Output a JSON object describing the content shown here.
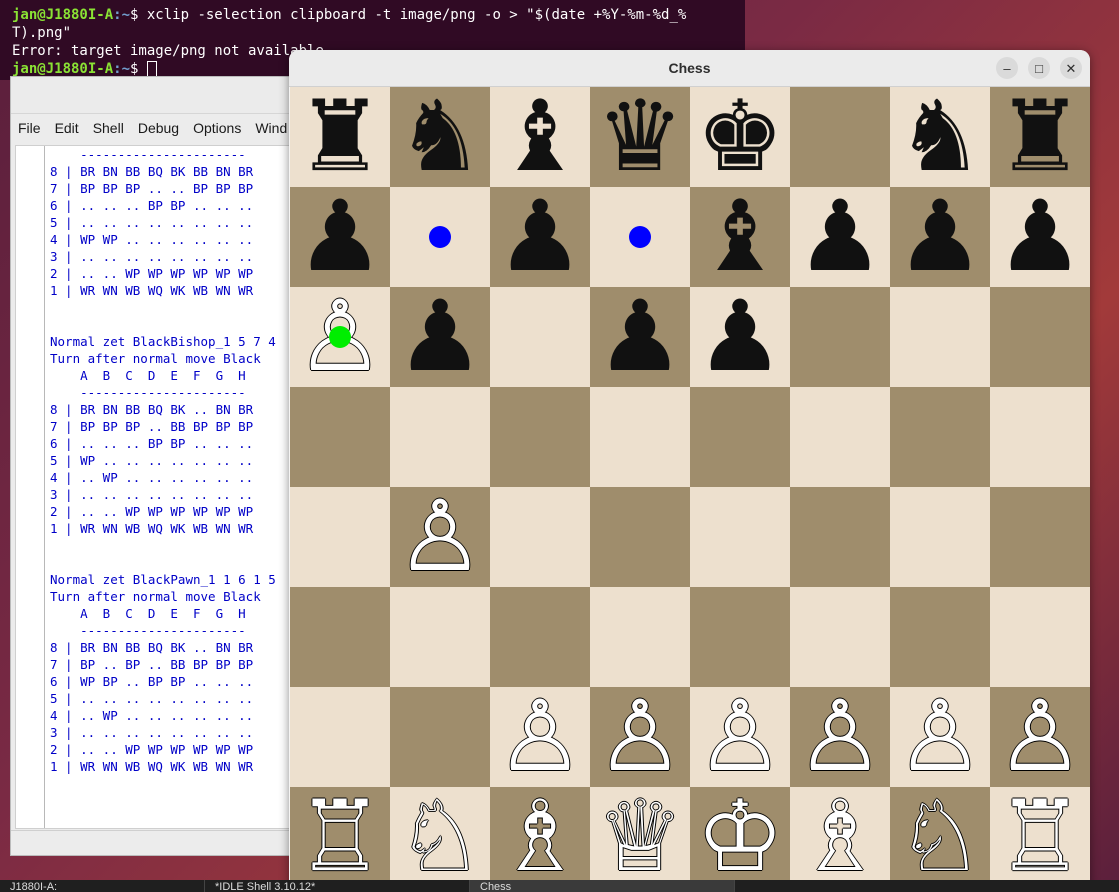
{
  "terminal": {
    "line1_user": "jan@J1880I-A",
    "line1_path": ":~",
    "line1_cmd": "$ xclip -selection clipboard -t image/png -o > \"$(date +%Y-%m-%d_%",
    "line2": "T).png\"",
    "line3": "Error: target image/png not available",
    "line4_user": "jan@J1880I-A",
    "line4_path": ":~",
    "line4_dollar": "$ "
  },
  "idle": {
    "menu": [
      "File",
      "Edit",
      "Shell",
      "Debug",
      "Options",
      "Wind"
    ],
    "lines": [
      "    ----------------------",
      "8 | BR BN BB BQ BK BB BN BR",
      "7 | BP BP BP .. .. BP BP BP",
      "6 | .. .. .. BP BP .. .. ..",
      "5 | .. .. .. .. .. .. .. ..",
      "4 | WP WP .. .. .. .. .. ..",
      "3 | .. .. .. .. .. .. .. ..",
      "2 | .. .. WP WP WP WP WP WP",
      "1 | WR WN WB WQ WK WB WN WR",
      "",
      "",
      "Normal zet BlackBishop_1 5 7 4",
      "Turn after normal move Black",
      "    A  B  C  D  E  F  G  H",
      "    ----------------------",
      "8 | BR BN BB BQ BK .. BN BR",
      "7 | BP BP BP .. BB BP BP BP",
      "6 | .. .. .. BP BP .. .. ..",
      "5 | WP .. .. .. .. .. .. ..",
      "4 | .. WP .. .. .. .. .. ..",
      "3 | .. .. .. .. .. .. .. ..",
      "2 | .. .. WP WP WP WP WP WP",
      "1 | WR WN WB WQ WK WB WN WR",
      "",
      "",
      "Normal zet BlackPawn_1 1 6 1 5",
      "Turn after normal move Black",
      "    A  B  C  D  E  F  G  H",
      "    ----------------------",
      "8 | BR BN BB BQ BK .. BN BR",
      "7 | BP .. BP .. BB BP BP BP",
      "6 | WP BP .. BP BP .. .. ..",
      "5 | .. .. .. .. .. .. .. ..",
      "4 | .. WP .. .. .. .. .. ..",
      "3 | .. .. .. .. .. .. .. ..",
      "2 | .. .. WP WP WP WP WP WP",
      "1 | WR WN WB WQ WK WB WN WR"
    ]
  },
  "chess": {
    "title": "Chess",
    "buttons": {
      "minimize": "–",
      "maximize": "□",
      "close": "✕"
    },
    "light_color": "#ede0ce",
    "dark_color": "#9f8d6c",
    "board": [
      [
        "♜",
        "♞",
        "♝",
        "♛",
        "♚",
        "",
        "♞",
        "♜"
      ],
      [
        "♟",
        "",
        "♟",
        "",
        "♝",
        "♟",
        "♟",
        "♟"
      ],
      [
        "♙",
        "♟",
        "",
        "♟",
        "♟",
        "",
        "",
        ""
      ],
      [
        "",
        "",
        "",
        "",
        "",
        "",
        "",
        ""
      ],
      [
        "",
        "♙",
        "",
        "",
        "",
        "",
        "",
        ""
      ],
      [
        "",
        "",
        "",
        "",
        "",
        "",
        "",
        ""
      ],
      [
        "",
        "",
        "♙",
        "♙",
        "♙",
        "♙",
        "♙",
        "♙"
      ],
      [
        "♖",
        "♘",
        "♗",
        "♕",
        "♔",
        "♗",
        "♘",
        "♖"
      ]
    ],
    "colors": [
      [
        "b",
        "b",
        "b",
        "b",
        "b",
        "",
        "b",
        "b"
      ],
      [
        "b",
        "",
        "b",
        "",
        "b",
        "b",
        "b",
        "b"
      ],
      [
        "w",
        "b",
        "",
        "b",
        "b",
        "",
        "",
        ""
      ],
      [
        "",
        "",
        "",
        "",
        "",
        "",
        "",
        ""
      ],
      [
        "",
        "w",
        "",
        "",
        "",
        "",
        "",
        ""
      ],
      [
        "",
        "",
        "",
        "",
        "",
        "",
        "",
        ""
      ],
      [
        "",
        "",
        "w",
        "w",
        "w",
        "w",
        "w",
        "w"
      ],
      [
        "w",
        "w",
        "w",
        "w",
        "w",
        "w",
        "w",
        "w"
      ]
    ],
    "move_hints": [
      {
        "row": 1,
        "col": 1,
        "color": "#0000ff"
      },
      {
        "row": 1,
        "col": 3,
        "color": "#0000ff"
      }
    ],
    "selected_marker": {
      "row": 2,
      "col": 0,
      "color": "#00ee00"
    }
  },
  "taskbar": {
    "items": [
      "J1880I-A:",
      "*IDLE Shell 3.10.12*",
      "Chess"
    ]
  }
}
